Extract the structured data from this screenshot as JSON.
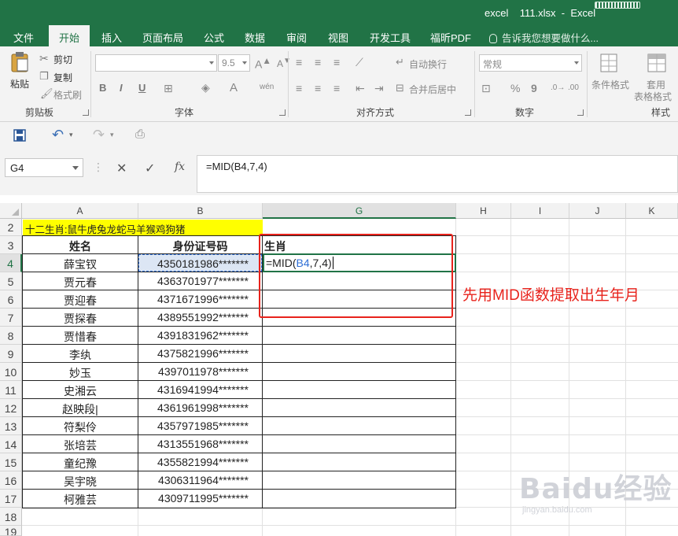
{
  "window": {
    "title": "excel    111.xlsx  -  Excel"
  },
  "tabs": [
    "文件",
    "开始",
    "插入",
    "页面布局",
    "公式",
    "数据",
    "审阅",
    "视图",
    "开发工具",
    "福昕PDF"
  ],
  "tell_me": "告诉我您想要做什么...",
  "ribbon": {
    "clipboard": {
      "label": "剪贴板",
      "paste": "粘贴",
      "cut": "剪切",
      "copy": "复制",
      "format_painter": "格式刷"
    },
    "font": {
      "label": "字体",
      "font_name": "",
      "font_size": "9.5",
      "bold": "B",
      "italic": "I",
      "underline": "U"
    },
    "alignment": {
      "label": "对齐方式",
      "wrap": "自动换行",
      "merge": "合并后居中"
    },
    "number": {
      "label": "数字",
      "format": "常规",
      "percent": "%",
      "comma": "9"
    },
    "styles": {
      "label": "样式",
      "conditional": "条件格式",
      "table_line1": "套用",
      "table_line2": "表格格式"
    }
  },
  "name_box": "G4",
  "formula": "=MID(B4,7,4)",
  "columns": [
    "A",
    "B",
    "G",
    "H",
    "I",
    "J",
    "K"
  ],
  "rows": [
    "2",
    "3",
    "4",
    "5",
    "6",
    "7",
    "8",
    "9",
    "10",
    "11",
    "12",
    "13",
    "14",
    "15",
    "16",
    "17",
    "18",
    "19"
  ],
  "sheet": {
    "banner": "十二生肖:鼠牛虎兔龙蛇马羊猴鸡狗猪",
    "headers": {
      "name": "姓名",
      "id": "身份证号码",
      "zodiac": "生肖"
    },
    "active_formula": {
      "prefix": "=MID(",
      "ref": "B4",
      "suffix": ",7,4)"
    },
    "records": [
      {
        "name": "薛宝钗",
        "id": "4350181986*******"
      },
      {
        "name": "贾元春",
        "id": "4363701977*******"
      },
      {
        "name": "贾迎春",
        "id": "4371671996*******"
      },
      {
        "name": "贾探春",
        "id": "4389551992*******"
      },
      {
        "name": "贾惜春",
        "id": "4391831962*******"
      },
      {
        "name": "李纨",
        "id": "4375821996*******"
      },
      {
        "name": "妙玉",
        "id": "4397011978*******"
      },
      {
        "name": "史湘云",
        "id": "4316941994*******"
      },
      {
        "name": "赵映段|",
        "id": "4361961998*******"
      },
      {
        "name": "符梨伶",
        "id": "4357971985*******"
      },
      {
        "name": "张培芸",
        "id": "4313551968*******"
      },
      {
        "name": "童纪豫",
        "id": "4355821994*******"
      },
      {
        "name": "吴宇晓",
        "id": "4306311964*******"
      },
      {
        "name": "柯雅芸",
        "id": "4309711995*******"
      }
    ]
  },
  "annotation": "先用MID函数提取出生年月",
  "watermark": {
    "brand": "Baidu经验",
    "url": "jingyan.baidu.com"
  },
  "colors": {
    "excel_green": "#217346",
    "banner_yellow": "#ffff00",
    "annotation_red": "#e8231c",
    "ref_blue": "#2f6fd6"
  }
}
